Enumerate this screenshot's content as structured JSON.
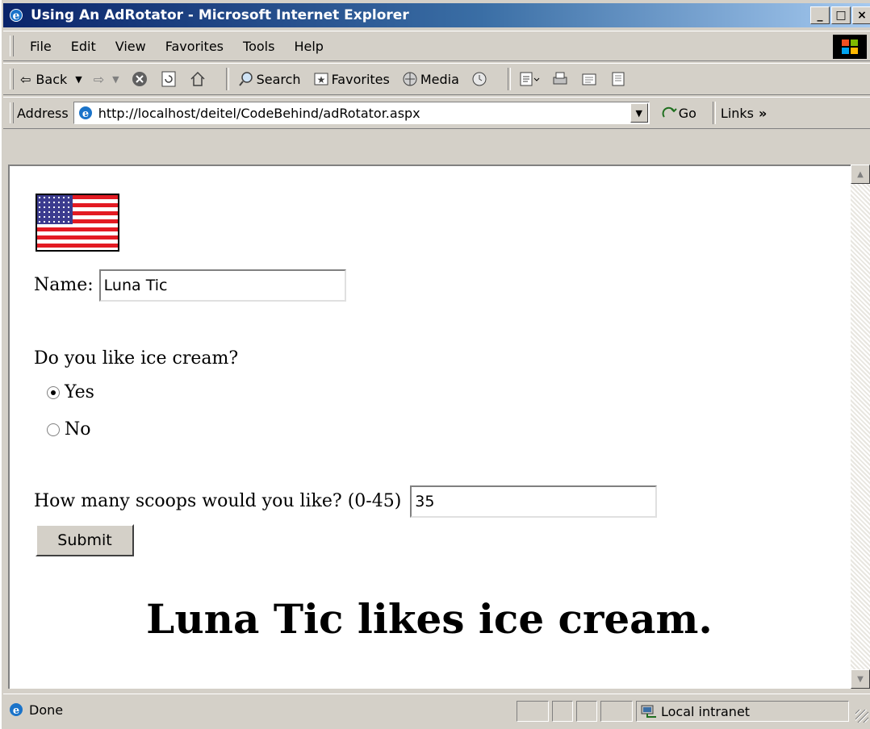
{
  "window": {
    "title": "Using An AdRotator - Microsoft Internet Explorer"
  },
  "menu": [
    "File",
    "Edit",
    "View",
    "Favorites",
    "Tools",
    "Help"
  ],
  "toolbar": {
    "back": "Back",
    "search": "Search",
    "favorites": "Favorites",
    "media": "Media"
  },
  "address": {
    "label": "Address",
    "url": "http://localhost/deitel/CodeBehind/adRotator.aspx",
    "go": "Go",
    "links": "Links",
    "links_more": "»"
  },
  "form": {
    "name_label": "Name:",
    "name_value": "Luna Tic",
    "question": "Do you like ice cream?",
    "options": [
      "Yes",
      "No"
    ],
    "selected": "Yes",
    "scoops_label": "How many scoops would you like? (0-45)",
    "scoops_value": "35",
    "submit": "Submit"
  },
  "result": "Luna Tic likes ice cream.",
  "status": {
    "text": "Done",
    "zone": "Local intranet"
  }
}
